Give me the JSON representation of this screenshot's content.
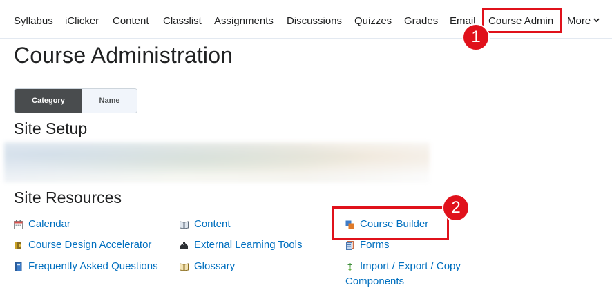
{
  "nav": {
    "items": [
      "Syllabus",
      "iClicker",
      "Content",
      "Classlist",
      "Assignments",
      "Discussions",
      "Quizzes",
      "Grades",
      "Email",
      "Course Admin"
    ],
    "more_label": "More"
  },
  "badges": {
    "one": "1",
    "two": "2"
  },
  "page": {
    "title": "Course Administration"
  },
  "view_toggle": {
    "category": "Category",
    "name": "Name",
    "selected": "Category"
  },
  "sections": {
    "site_setup": "Site Setup",
    "site_resources": "Site Resources"
  },
  "resources": {
    "calendar": "Calendar",
    "course_design_accelerator": "Course Design Accelerator",
    "faq": "Frequently Asked Questions",
    "content": "Content",
    "external_learning_tools": "External Learning Tools",
    "glossary": "Glossary",
    "course_builder": "Course Builder",
    "forms": "Forms",
    "import_export_line1": "Import / Export / Copy",
    "import_export_line2": "Components"
  },
  "colors": {
    "link": "#006fbf",
    "highlight": "#e0111b",
    "toggle_active": "#494c4e"
  }
}
